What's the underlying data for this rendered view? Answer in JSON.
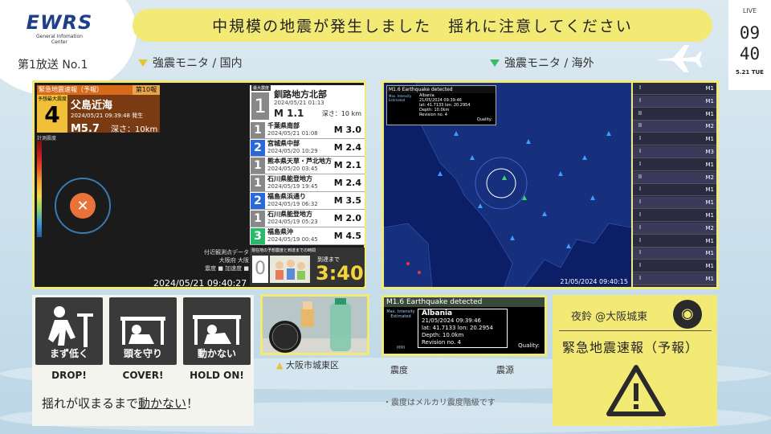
{
  "brand": {
    "logo": "EWRS",
    "subtitle1": "General Infomation",
    "subtitle2": "Center"
  },
  "channel": "第1放送  No.1",
  "banner": "中規模の地震が発生しました　揺れに注意してください",
  "clock": {
    "live": "LIVE",
    "hour": "09",
    "minute": "40",
    "date": "5.21 TUE"
  },
  "sections": {
    "domestic": "強震モニタ / 国内",
    "overseas": "強震モニタ / 海外"
  },
  "eew": {
    "header": "緊急地震速報（予報）",
    "report_no": "第10報",
    "intensity_label": "予想最大震度",
    "intensity": "4",
    "place": "父島近海",
    "time": "2024/05/21 09:39:48 発生",
    "magnitude": "M5.7",
    "depth": "深さ：10km",
    "scale_label": "計測震度"
  },
  "monitor_timestamp": "2024/05/21 09:40:27",
  "nearby": {
    "line1": "付近観測点データ",
    "line2": "大阪府 大阪",
    "line3": "震度 ■  加速度 ■"
  },
  "latest": {
    "header": "最大震度",
    "intensity": "1",
    "place": "釧路地方北部",
    "time": "2024/05/21 01:13",
    "magnitude": "M 1.1",
    "depth": "深さ：10 km"
  },
  "quakes": [
    {
      "i": "1",
      "place": "千葉県南部",
      "time": "2024/05/21 01:08",
      "mag": "M 3.0",
      "color": "#888888"
    },
    {
      "i": "2",
      "place": "宮城県中部",
      "time": "2024/05/20 10:29",
      "mag": "M 2.4",
      "color": "#2a6ad8"
    },
    {
      "i": "1",
      "place": "熊本県天草・芦北地方",
      "time": "2024/05/20 03:45",
      "mag": "M 2.1",
      "color": "#888888"
    },
    {
      "i": "1",
      "place": "石川県能登地方",
      "time": "2024/05/19 19:45",
      "mag": "M 2.4",
      "color": "#888888"
    },
    {
      "i": "2",
      "place": "福島県浜通り",
      "time": "2024/05/19 06:32",
      "mag": "M 3.5",
      "color": "#2a6ad8"
    },
    {
      "i": "1",
      "place": "石川県能登地方",
      "time": "2024/05/19 05:23",
      "mag": "M 2.0",
      "color": "#888888"
    },
    {
      "i": "3",
      "place": "福島県沖",
      "time": "2024/05/19 00:45",
      "mag": "M 4.5",
      "color": "#2ab86a"
    }
  ],
  "arrival": {
    "label": "現在地の予想震度と到達までの時間",
    "intensity": "0",
    "sublabel": "到達まで",
    "time": "3:40"
  },
  "overseas": {
    "title": "M1.6 Earthquake detected",
    "max_int_label": "Max. Intensity Estimated",
    "region": "Albania",
    "time": "21/05/2024 09:39:46",
    "coords": "lat: 41.7133 lon: 20.2954",
    "depth": "Depth: 10.0km",
    "revision": "Revision no. 4",
    "quality": "Quality:",
    "map_timestamp": "21/05/2024 09:40:15",
    "mmi": "MMI"
  },
  "side_events": [
    {
      "n": "I",
      "mag": "M1"
    },
    {
      "n": "I",
      "mag": "M1"
    },
    {
      "n": "II",
      "mag": "M1"
    },
    {
      "n": "II",
      "mag": "M2"
    },
    {
      "n": "I",
      "mag": "M1"
    },
    {
      "n": "I",
      "mag": "M3"
    },
    {
      "n": "I",
      "mag": "M1"
    },
    {
      "n": "II",
      "mag": "M2"
    },
    {
      "n": "I",
      "mag": "M1"
    },
    {
      "n": "I",
      "mag": "M1"
    },
    {
      "n": "I",
      "mag": "M1"
    },
    {
      "n": "I",
      "mag": "M2"
    },
    {
      "n": "I",
      "mag": "M1"
    },
    {
      "n": "I",
      "mag": "M1"
    },
    {
      "n": "I",
      "mag": "M1"
    },
    {
      "n": "I",
      "mag": "M1"
    }
  ],
  "legend": {
    "intensity": "震度",
    "epicenter": "震源"
  },
  "note": "・震度はメルカリ震度階級です",
  "alert": {
    "who": "夜鈴 @大阪城東",
    "title": "緊急地震速報（予報）"
  },
  "actions": [
    {
      "cap": "まず低く",
      "label": "DROP!"
    },
    {
      "cap": "頭を守り",
      "label": "COVER!"
    },
    {
      "cap": "動かない",
      "label": "HOLD ON!"
    }
  ],
  "motto": {
    "before": "揺れが収まるまで",
    "underlined": "動かない",
    "after": "！"
  },
  "camera": {
    "label": "大阪市城東区"
  },
  "colors": {
    "banner": "#f3ea76",
    "eew_orange": "#d86a1c",
    "arrival_yellow": "#f3d43a"
  }
}
